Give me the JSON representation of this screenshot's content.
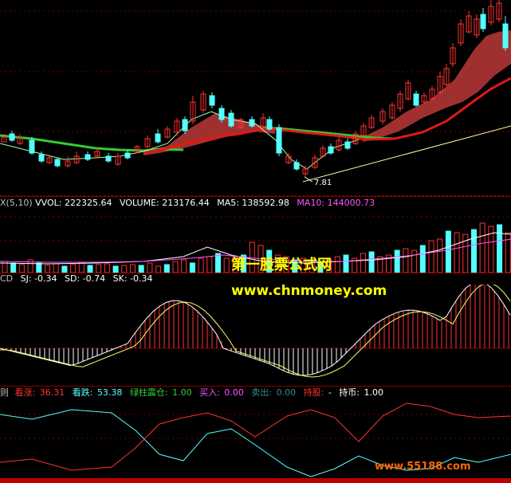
{
  "price_panel": {
    "low_label": "7.81",
    "colors": {
      "up": "#ff3232",
      "down": "#54ffff",
      "ma_red": "#e01818",
      "ma_green": "#33cc33",
      "ribbon": "#a03030",
      "trend": "#ffff99",
      "thin": "#aaffaa"
    }
  },
  "volume_panel": {
    "prefix": "X(5,10)",
    "vol_label": "VVOL: 222325.64",
    "volume_label": "VOLUME: 213176.44",
    "ma5_label": "MA5: 138592.98",
    "ma10_label": "MA10: 144000.73"
  },
  "macd_panel": {
    "prefix": "CD",
    "sj_label": "SJ: -0.34",
    "sd_label": "SD: -0.74",
    "sk_label": "SK: -0.34"
  },
  "indicator_panel": {
    "prefix": "则",
    "rise_label": "看涨:",
    "rise_value": "36.31",
    "fall_label": "看跌:",
    "fall_value": "53.38",
    "green_label": "绿柱震仓:",
    "green_value": "1.00",
    "buy_label": "买入:",
    "buy_value": "0.00",
    "sell_label": "卖出:",
    "sell_value": "0.00",
    "hold_label": "持股:",
    "hold_value": "-",
    "coin_label": "持币:",
    "coin_value": "1.00"
  },
  "watermark": {
    "title": "第一股票公式网",
    "url": "www.chnmoney.com",
    "site2": "www.55188.com"
  }
}
